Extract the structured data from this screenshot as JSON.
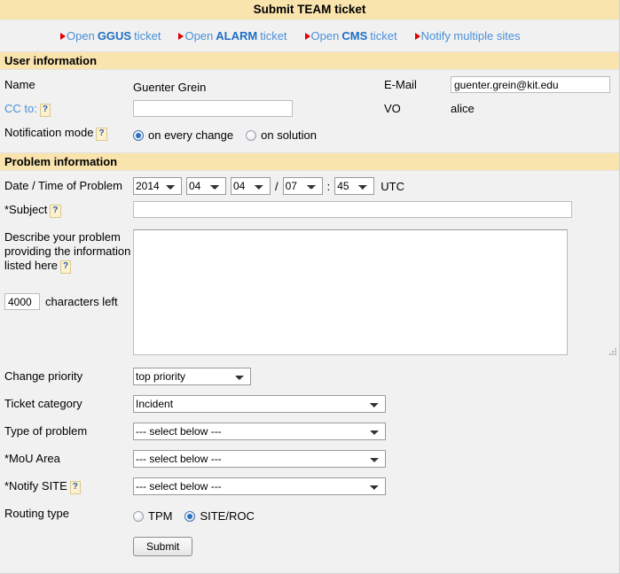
{
  "window": {
    "title": "Submit TEAM ticket"
  },
  "nav": {
    "links": [
      {
        "pre": "Open",
        "strong": "GGUS",
        "post": "ticket",
        "name": "open-ggus-ticket-link"
      },
      {
        "pre": "Open",
        "strong": "ALARM",
        "post": "ticket",
        "name": "open-alarm-ticket-link"
      },
      {
        "pre": "Open",
        "strong": "CMS",
        "post": "ticket",
        "name": "open-cms-ticket-link"
      },
      {
        "pre": "Notify multiple sites",
        "strong": "",
        "post": "",
        "name": "notify-multiple-sites-link"
      }
    ]
  },
  "user_section": {
    "header": "User information",
    "name_label": "Name",
    "name_value": "Guenter Grein",
    "email_label": "E-Mail",
    "email_value": "guenter.grein@kit.edu",
    "cc_label": "CC to:",
    "cc_value": "",
    "vo_label": "VO",
    "vo_value": "alice",
    "notification_label": "Notification mode",
    "notification_options": [
      {
        "label": "on every change",
        "selected": true
      },
      {
        "label": "on solution",
        "selected": false
      }
    ],
    "help_glyph": "?"
  },
  "problem_section": {
    "header": "Problem information",
    "datetime_label": "Date / Time of Problem",
    "date": {
      "year": "2014",
      "month": "04",
      "day": "04",
      "hour": "07",
      "minute": "45",
      "date_separator": "/",
      "time_separator": ":",
      "timezone": "UTC"
    },
    "subject_label": "*Subject",
    "subject_value": "",
    "describe_label_line1": "Describe your problem",
    "describe_label_line2": "providing the information",
    "describe_label_line3": "listed here",
    "description_value": "",
    "chars_left_value": "4000",
    "chars_left_label": "characters left",
    "priority_label": "Change priority",
    "priority_value": "top priority",
    "category_label": "Ticket category",
    "category_value": "Incident",
    "type_label": "Type of problem",
    "type_value": "--- select below ---",
    "mou_label": "*MoU Area",
    "mou_value": "--- select below ---",
    "notify_site_label": "*Notify SITE",
    "notify_site_value": "--- select below ---",
    "routing_label": "Routing type",
    "routing_options": [
      {
        "label": "TPM",
        "selected": false
      },
      {
        "label": "SITE/ROC",
        "selected": true
      }
    ]
  },
  "footer": {
    "submit_label": "Submit"
  },
  "colors": {
    "title_bar": "#fae4ae",
    "section_header": "#fae4ae",
    "page_background": "#f1f1f1",
    "link_blue": "#4a90d9",
    "link_blue_strong": "#1f6fc4",
    "arrow_red": "#e00000",
    "radio_selected": "#2e6fc0"
  }
}
